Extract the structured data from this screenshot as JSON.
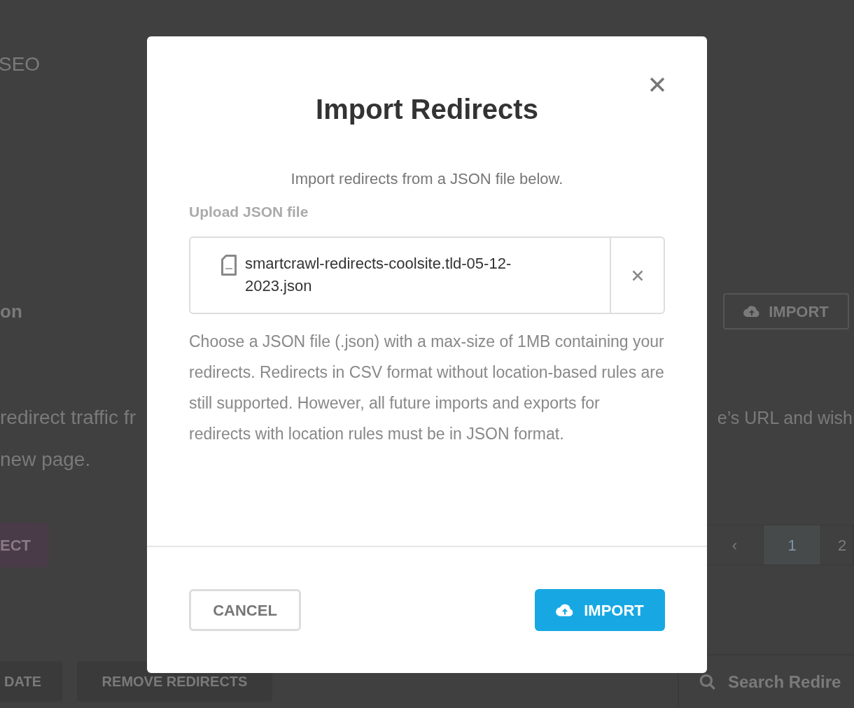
{
  "background": {
    "heading": "SEO",
    "section_title": "on",
    "import_button": "IMPORT",
    "text_left": "redirect traffic fr",
    "text_right": "e’s URL and wish",
    "text_left_2": "new page.",
    "add_button": "ECT",
    "pagination": [
      {
        "label": "‹",
        "selected": false
      },
      {
        "label": "1",
        "selected": true
      },
      {
        "label": "2",
        "selected": false
      }
    ],
    "bulk_buttons": [
      "DATE",
      "REMOVE REDIRECTS"
    ],
    "search": {
      "placeholder": "Search Redire"
    }
  },
  "dialog": {
    "title": "Import Redirects",
    "intro": "Import redirects from a JSON file below.",
    "field_label": "Upload JSON file",
    "file": {
      "name": "smartcrawl-redirects-coolsite.tld-05-12-2023.json"
    },
    "help": "Choose a JSON file (.json) with a max-size of 1MB containing your redirects. Redirects in CSV format without location-based rules are still supported. However, all future imports and exports for redirects with location rules must be in JSON format.",
    "buttons": [
      {
        "label": "CANCEL",
        "kind": "secondary"
      },
      {
        "label": "IMPORT",
        "kind": "primary"
      }
    ]
  }
}
